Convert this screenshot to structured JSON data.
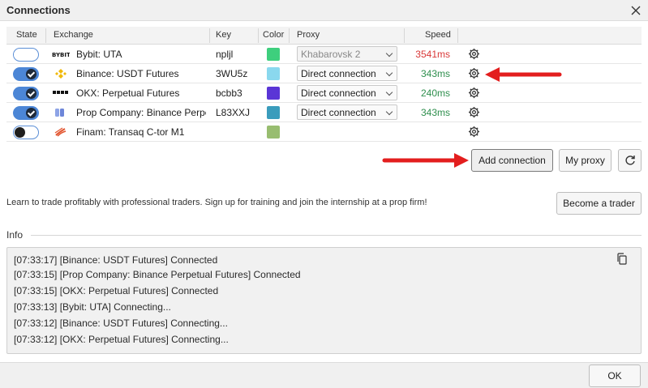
{
  "window": {
    "title": "Connections"
  },
  "table": {
    "headers": {
      "state": "State",
      "exchange": "Exchange",
      "key": "Key",
      "color": "Color",
      "proxy": "Proxy",
      "speed": "Speed"
    },
    "rows": [
      {
        "state": "off",
        "logo": "bybit-logo",
        "exchange": "Bybit: UTA",
        "key": "npljl",
        "color": "#3ecf7d",
        "proxy": "Khabarovsk 2",
        "speed": "3541ms",
        "speed_color": "#d93838"
      },
      {
        "state": "on",
        "logo": "binance-logo",
        "exchange": "Binance: USDT Futures",
        "key": "3WU5z",
        "color": "#8ad8ee",
        "proxy": "Direct connection",
        "speed": "343ms",
        "speed_color": "#2f8f4e"
      },
      {
        "state": "on",
        "logo": "okx-logo",
        "exchange": "OKX: Perpetual Futures",
        "key": "bcbb3",
        "color": "#5a35d6",
        "proxy": "Direct connection",
        "speed": "240ms",
        "speed_color": "#2f8f4e"
      },
      {
        "state": "on",
        "logo": "prop-company-logo",
        "exchange": "Prop Company: Binance Perpetual Futures",
        "key": "L83XXJ",
        "color": "#3a9cbc",
        "proxy": "Direct connection",
        "speed": "343ms",
        "speed_color": "#2f8f4e"
      },
      {
        "state": "off-dark",
        "logo": "finam-logo",
        "exchange": "Finam: Transaq C-tor M1",
        "key": "",
        "color": "#98bd70",
        "proxy": "",
        "speed": ""
      }
    ]
  },
  "actions": {
    "add_connection": "Add connection",
    "my_proxy": "My proxy",
    "refresh_icon": "refresh-icon"
  },
  "promo": {
    "text": "Learn to trade profitably with professional traders. Sign up for training and join the internship at a prop firm!",
    "button": "Become a trader"
  },
  "info": {
    "label": "Info",
    "lines": [
      "[07:33:17] [Binance: USDT Futures] Connected",
      "[07:33:15] [Prop Company: Binance Perpetual Futures] Connected",
      "[07:33:15] [OKX: Perpetual Futures] Connected",
      "[07:33:13] [Bybit: UTA] Connecting...",
      "[07:33:12] [Binance: USDT Futures] Connecting...",
      "[07:33:12] [OKX: Perpetual Futures] Connecting..."
    ]
  },
  "footer": {
    "ok": "OK"
  }
}
